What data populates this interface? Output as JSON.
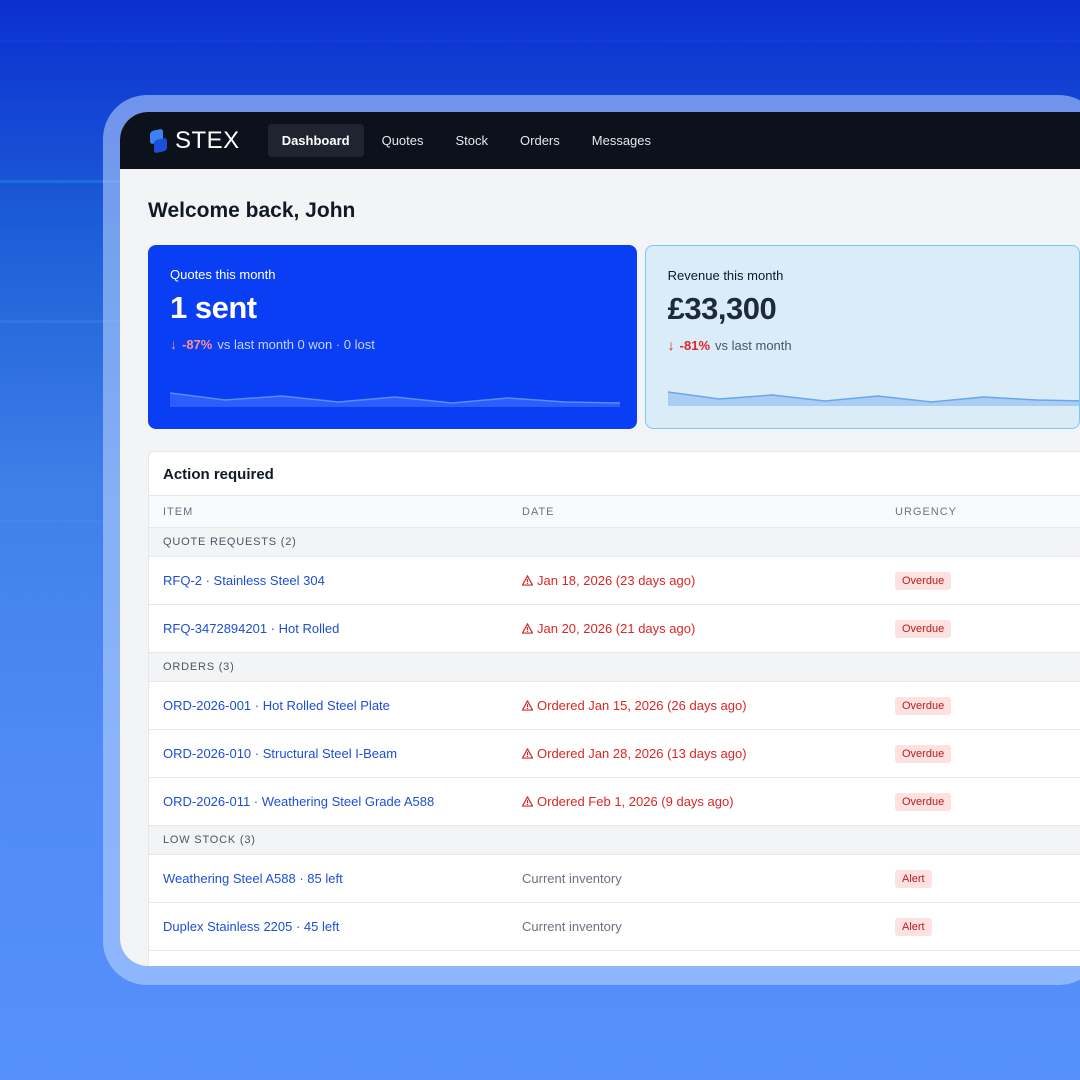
{
  "app": {
    "brand": "STEX",
    "nav": [
      {
        "label": "Dashboard",
        "active": true
      },
      {
        "label": "Quotes",
        "active": false
      },
      {
        "label": "Stock",
        "active": false
      },
      {
        "label": "Orders",
        "active": false
      },
      {
        "label": "Messages",
        "active": false
      }
    ]
  },
  "welcome": "Welcome back, John",
  "stats": {
    "quotes": {
      "label": "Quotes this month",
      "value": "1 sent",
      "delta": "-87%",
      "sub": "vs last month 0 won · 0 lost"
    },
    "revenue": {
      "label": "Revenue this month",
      "value": "£33,300",
      "delta": "-81%",
      "sub": "vs last month"
    }
  },
  "action": {
    "title": "Action required",
    "columns": {
      "item": "ITEM",
      "date": "DATE",
      "urgency": "URGENCY"
    },
    "groups": {
      "quotes": {
        "label": "QUOTE REQUESTS (2)",
        "rows": [
          {
            "item": "RFQ-2 · Stainless Steel 304",
            "date": "Jan 18, 2026 (23 days ago)",
            "urgency": "Overdue"
          },
          {
            "item": "RFQ-3472894201 · Hot Rolled",
            "date": "Jan 20, 2026 (21 days ago)",
            "urgency": "Overdue"
          }
        ]
      },
      "orders": {
        "label": "ORDERS (3)",
        "rows": [
          {
            "item": "ORD-2026-001 · Hot Rolled Steel Plate",
            "date": "Ordered Jan 15, 2026 (26 days ago)",
            "urgency": "Overdue"
          },
          {
            "item": "ORD-2026-010 · Structural Steel I-Beam",
            "date": "Ordered Jan 28, 2026 (13 days ago)",
            "urgency": "Overdue"
          },
          {
            "item": "ORD-2026-011 · Weathering Steel Grade A588",
            "date": "Ordered Feb 1, 2026 (9 days ago)",
            "urgency": "Overdue"
          }
        ]
      },
      "stock": {
        "label": "LOW STOCK (3)",
        "rows": [
          {
            "item": "Weathering Steel A588 · 85 left",
            "date": "Current inventory",
            "urgency": "Alert"
          },
          {
            "item": "Duplex Stainless 2205 · 45 left",
            "date": "Current inventory",
            "urgency": "Alert"
          }
        ]
      }
    }
  },
  "colors": {
    "brand_blue": "#0a3ef5",
    "danger": "#dc2626",
    "link": "#1d4ed8"
  },
  "icons": {
    "logo": "stex-logo-icon",
    "down_arrow": "arrow-down-icon",
    "warning": "warning-triangle-icon"
  }
}
